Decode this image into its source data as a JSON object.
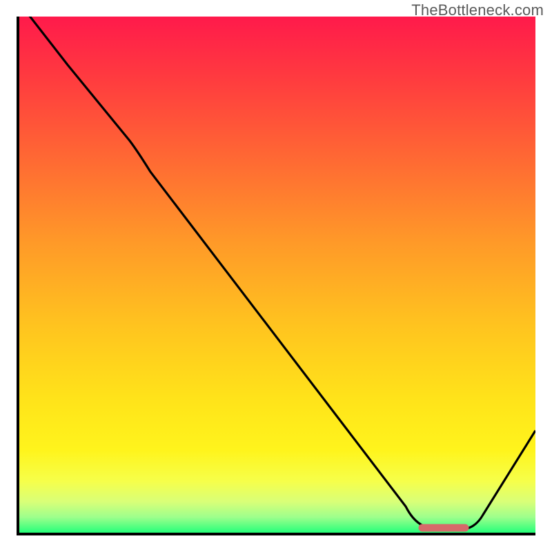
{
  "watermark": "TheBottleneck.com",
  "chart_data": {
    "type": "line",
    "title": "",
    "xlabel": "",
    "ylabel": "",
    "xlim": [
      0,
      100
    ],
    "ylim": [
      0,
      100
    ],
    "grid": false,
    "legend": false,
    "notes": "No axis tick labels are rendered in the image; x/y units unknown. Values below are read off by position within the plot rectangle (0–100 each axis, y=0 at bottom).",
    "series": [
      {
        "name": "curve",
        "color": "#000000",
        "x": [
          0,
          9,
          21,
          25,
          40,
          55,
          70,
          75,
          80,
          86,
          90,
          100
        ],
        "y": [
          103,
          91,
          76,
          70,
          47,
          25,
          8,
          3,
          0.8,
          0.8,
          3,
          20
        ]
      }
    ],
    "markers": [
      {
        "name": "optimal-range",
        "color": "#d66a6a",
        "y": 0.9,
        "x_start": 78,
        "x_end": 86
      }
    ],
    "background": {
      "type": "vertical-gradient",
      "stops": [
        {
          "pos": 0.0,
          "color": "#ff1a4b"
        },
        {
          "pos": 0.28,
          "color": "#ff6a33"
        },
        {
          "pos": 0.6,
          "color": "#ffc41f"
        },
        {
          "pos": 0.84,
          "color": "#fff41c"
        },
        {
          "pos": 0.97,
          "color": "#9dff8c"
        },
        {
          "pos": 1.0,
          "color": "#26ff7a"
        }
      ]
    }
  }
}
